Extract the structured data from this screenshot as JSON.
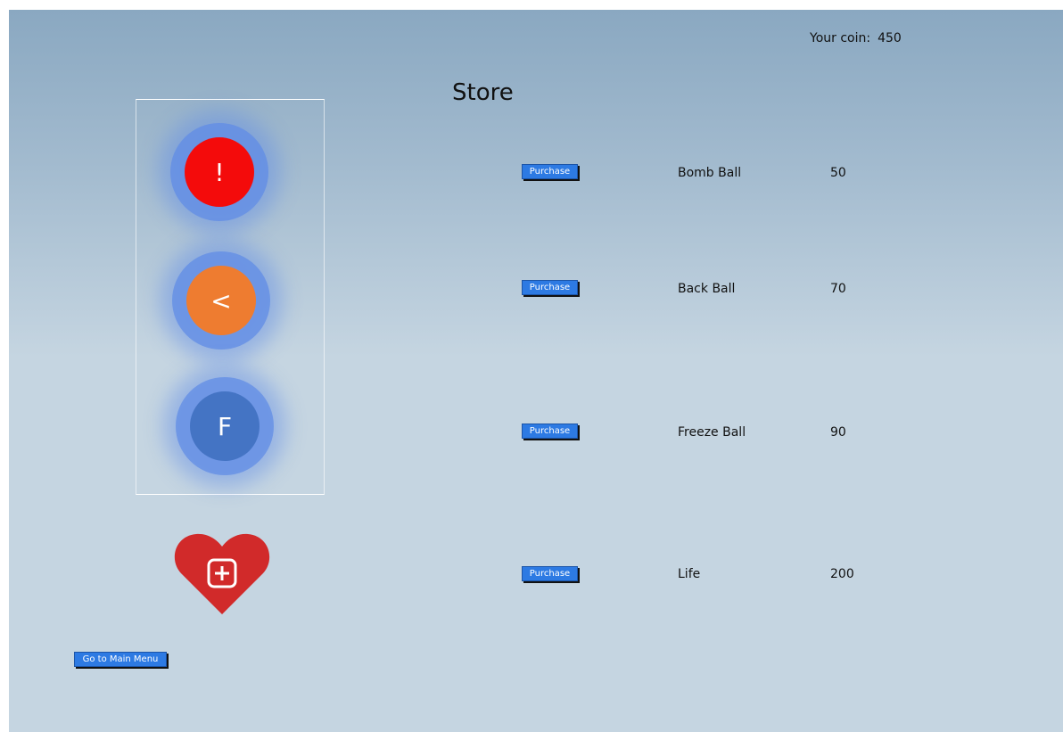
{
  "header": {
    "coin_label": "Your coin:",
    "coin_value": "450"
  },
  "store": {
    "title": "Store",
    "items": [
      {
        "name": "Bomb Ball",
        "price": "50",
        "purchase_label": "Purchase"
      },
      {
        "name": "Back Ball",
        "price": "70",
        "purchase_label": "Purchase"
      },
      {
        "name": "Freeze Ball",
        "price": "90",
        "purchase_label": "Purchase"
      },
      {
        "name": "Life",
        "price": "200",
        "purchase_label": "Purchase"
      }
    ]
  },
  "balls": {
    "bomb_symbol": "!",
    "back_symbol": "<",
    "freeze_symbol": "F"
  },
  "icons": {
    "bomb_ball": "exclamation-ball-icon",
    "back_ball": "back-arrow-ball-icon",
    "freeze_ball": "freeze-ball-icon",
    "life": "heart-plus-icon"
  },
  "colors": {
    "bomb_ball": "#f40b0b",
    "back_ball": "#ee7c30",
    "freeze_ball": "#4474c4",
    "glow": "#608ce6",
    "heart": "#d12a2a",
    "button": "#2d7ae3"
  },
  "navigation": {
    "main_menu_label": "Go to Main Menu"
  }
}
